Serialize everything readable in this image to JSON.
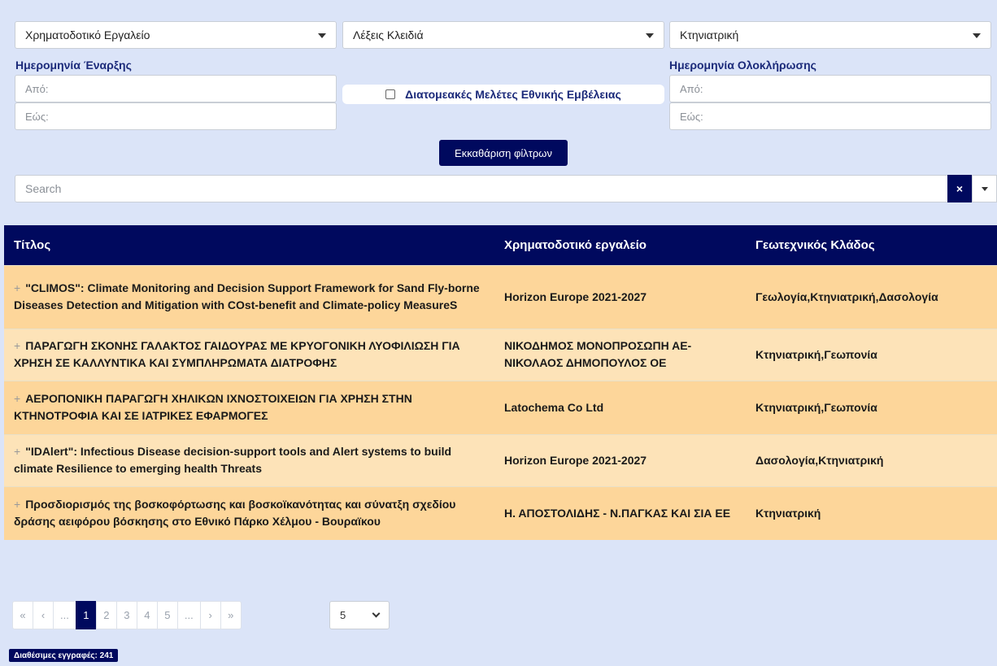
{
  "filters": {
    "funding_tool": "Χρηματοδοτικό Εργαλείο",
    "keywords": "Λέξεις Κλειδιά",
    "sector": "Κτηνιατρική",
    "start_date_label": "Ημερομηνία Έναρξης",
    "end_date_label": "Ημερομηνία Ολοκλήρωσης",
    "from_placeholder": "Από:",
    "to_placeholder": "Εώς:",
    "interdisciplinary_label": "Διατομεακές Μελέτες Εθνικής Εμβέλειας",
    "clear_label": "Εκκαθάριση φίλτρων"
  },
  "search": {
    "placeholder": "Search",
    "clear_glyph": "×"
  },
  "table": {
    "columns": [
      "Τίτλος",
      "Χρηματοδοτικό εργαλείο",
      "Γεωτεχνικός Κλάδος"
    ],
    "rows": [
      {
        "title": "\"CLIMOS\": Climate Monitoring and Decision Support Framework for Sand Fly-borne Diseases Detection and Mitigation with COst-benefit and Climate-policy MeasureS",
        "funding": "Horizon Europe 2021-2027",
        "sector": "Γεωλογία,Κτηνιατρική,Δασολογία"
      },
      {
        "title": "ΠΑΡΑΓΩΓΗ ΣΚΟΝΗΣ ΓΑΛΑΚΤΟΣ ΓΑΙΔΟΥΡΑΣ ΜΕ ΚΡΥΟΓΟΝΙΚΗ ΛΥΟΦΙΛΙΩΣΗ ΓΙΑ ΧΡΗΣΗ ΣΕ ΚΑΛΛΥΝΤΙΚΑ ΚΑΙ ΣΥΜΠΛΗΡΩΜΑΤΑ ΔΙΑΤΡΟΦΗΣ",
        "funding": "ΝΙΚΟΔΗΜΟΣ ΜΟΝΟΠΡΟΣΩΠΗ ΑΕ-ΝΙΚΟΛΑΟΣ ΔΗΜΟΠΟΥΛΟΣ ΟΕ",
        "sector": "Κτηνιατρική,Γεωπονία"
      },
      {
        "title": "ΑΕΡΟΠΟΝΙΚΗ ΠΑΡΑΓΩΓΗ ΧΗΛΙΚΩΝ ΙΧΝΟΣΤΟΙΧΕΙΩΝ ΓΙΑ ΧΡΗΣΗ ΣΤΗΝ ΚΤΗΝΟΤΡΟΦΙΑ ΚΑΙ ΣΕ ΙΑΤΡΙΚΕΣ ΕΦΑΡΜΟΓΕΣ",
        "funding": "Latochema Co Ltd",
        "sector": "Κτηνιατρική,Γεωπονία"
      },
      {
        "title": "\"IDAlert\": Infectious Disease decision-support tools and Alert systems to build climate Resilience to emerging health Threats",
        "funding": "Horizon Europe 2021-2027",
        "sector": "Δασολογία,Κτηνιατρική"
      },
      {
        "title": "Προσδιορισμός της βοσκοφόρτωσης και βοσκοϊκανότητας και σύνατξη σχεδίου δράσης αειφόρου βόσκησης στο Εθνικό Πάρκο Χέλμου - Βουραϊκου",
        "funding": "Η. ΑΠΟΣΤΟΛΙΔΗΣ - Ν.ΠΑΓΚΑΣ ΚΑΙ ΣΙΑ ΕΕ",
        "sector": "Κτηνιατρική"
      }
    ],
    "expand_glyph": "+"
  },
  "pagination": {
    "first": "«",
    "prev": "‹",
    "ellipsis_left": "...",
    "pages": [
      "1",
      "2",
      "3",
      "4",
      "5"
    ],
    "active_page": "1",
    "ellipsis_right": "...",
    "next": "›",
    "last": "»",
    "per_page": "5"
  },
  "records_label": "Διαθέσιμες εγγραφές: 241",
  "colors": {
    "navy": "#00095e",
    "row_odd": "#fdd69a",
    "row_even": "#fde3b8",
    "background": "#dbe4f8"
  }
}
